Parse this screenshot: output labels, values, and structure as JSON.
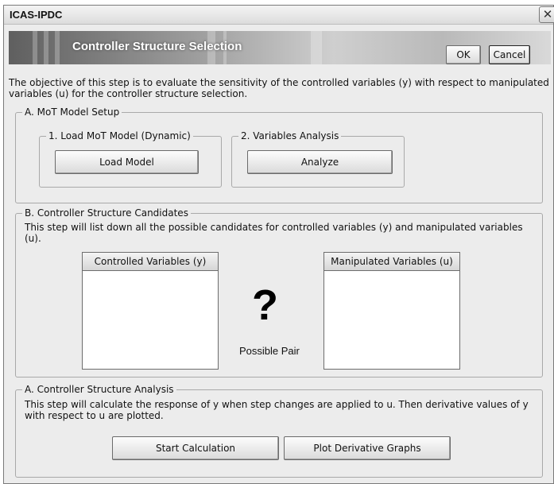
{
  "window": {
    "title": "ICAS-IPDC",
    "close_glyph": "✕"
  },
  "banner": {
    "title": "Controller Structure Selection"
  },
  "dialog_buttons": {
    "ok": "OK",
    "cancel": "Cancel"
  },
  "objective_text": "The objective of this step is to evaluate the sensitivity of the controlled variables (y) with respect to manipulated variables (u) for the controller structure selection.",
  "section_a": {
    "legend": "A. MoT Model Setup",
    "load": {
      "legend": "1. Load MoT Model (Dynamic)",
      "button": "Load Model"
    },
    "analysis": {
      "legend": "2. Variables Analysis",
      "button": "Analyze"
    }
  },
  "section_b": {
    "legend": "B. Controller Structure Candidates",
    "description": "This step will list down all the possible candidates for controlled variables (y) and manipulated variables (u).",
    "controlled_header": "Controlled Variables (y)",
    "manipulated_header": "Manipulated Variables (u)",
    "question_mark": "?",
    "possible_pair": "Possible Pair"
  },
  "section_c": {
    "legend": "A. Controller Structure Analysis",
    "description": "This step will calculate the response of y when step changes are applied to u. Then derivative values of y with respect to u are plotted.",
    "start_button": "Start Calculation",
    "plot_button": "Plot Derivative Graphs"
  }
}
